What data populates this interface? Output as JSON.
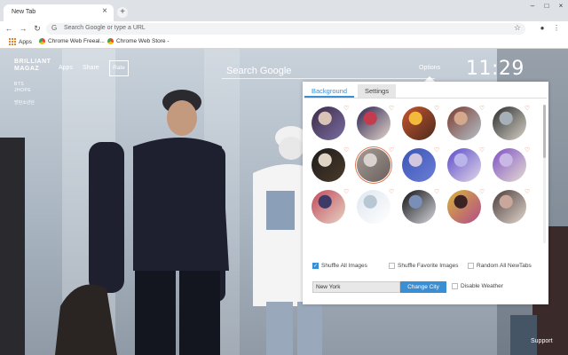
{
  "browser": {
    "tab_title": "New Tab",
    "tab_close": "×",
    "new_tab": "+",
    "window_controls": [
      "–",
      "□",
      "×"
    ],
    "omnibox_placeholder": "Search Google or type a URL",
    "bookmarks": [
      {
        "label": "Apps",
        "icon": "apps-grid-icon"
      },
      {
        "label": "Chrome Web Freeal...",
        "icon": "chrome-web-store-icon"
      },
      {
        "label": "Chrome Web Store -",
        "icon": "chrome-web-store-icon"
      }
    ]
  },
  "page": {
    "brand_title_1": "BRILLIANT",
    "brand_title_2": "MAGAZ",
    "brand_sub": "BTS",
    "brand_sub2": "JHOPE",
    "brand_sub3": "방탄소년단",
    "nav": {
      "apps": "Apps",
      "share": "Share",
      "rate": "Rate"
    },
    "search_placeholder": "Search Google",
    "options": "Options",
    "clock": "11:29",
    "support": "Support"
  },
  "panel": {
    "tabs": {
      "background": "Background",
      "settings": "Settings"
    },
    "thumbnails": [
      {
        "colors": [
          "#3b2a45",
          "#d8c3b6",
          "#7a6ea3"
        ]
      },
      {
        "colors": [
          "#2a2250",
          "#c23c4e",
          "#e5d6cb"
        ]
      },
      {
        "colors": [
          "#c8552f",
          "#f2b93a",
          "#4a2a1e"
        ]
      },
      {
        "colors": [
          "#7a3a2e",
          "#d3a88c",
          "#b5c3cc"
        ]
      },
      {
        "colors": [
          "#2c2c2c",
          "#a6b0b8",
          "#d7d2c8"
        ]
      },
      {
        "colors": [
          "#1c1c1c",
          "#e0d4c4",
          "#4b3a2a"
        ]
      },
      {
        "colors": [
          "#a59c97",
          "#d9d2cf",
          "#6a5f5b"
        ],
        "selected": true
      },
      {
        "colors": [
          "#3a53b5",
          "#d2c7df",
          "#6c7fd6"
        ]
      },
      {
        "colors": [
          "#5b4bc9",
          "#b9b4ea",
          "#e2d7e8"
        ]
      },
      {
        "colors": [
          "#7e4fc7",
          "#c9b7e6",
          "#e6ddd0"
        ]
      },
      {
        "colors": [
          "#c24a5a",
          "#3d3a68",
          "#e6d3c4"
        ]
      },
      {
        "colors": [
          "#dfe7ef",
          "#b8c7d4",
          "#ffffff"
        ]
      },
      {
        "colors": [
          "#111111",
          "#7a8fb8",
          "#d6d8e0"
        ]
      },
      {
        "colors": [
          "#d8b43a",
          "#3b2323",
          "#b34a8a"
        ]
      },
      {
        "colors": [
          "#4a3c3c",
          "#c9a79a",
          "#e2d6cc"
        ]
      }
    ],
    "heart": "♡",
    "checkboxes": [
      {
        "label": "Shuffle All Images",
        "checked": true
      },
      {
        "label": "Shuffle Favorite Images",
        "checked": false
      },
      {
        "label": "Random All NewTabs",
        "checked": false
      }
    ],
    "city_value": "New York",
    "change_city": "Change City",
    "disable_weather": "Disable Weather"
  },
  "colors": {
    "accent": "#3a8ed4",
    "heart": "#e0794e"
  }
}
